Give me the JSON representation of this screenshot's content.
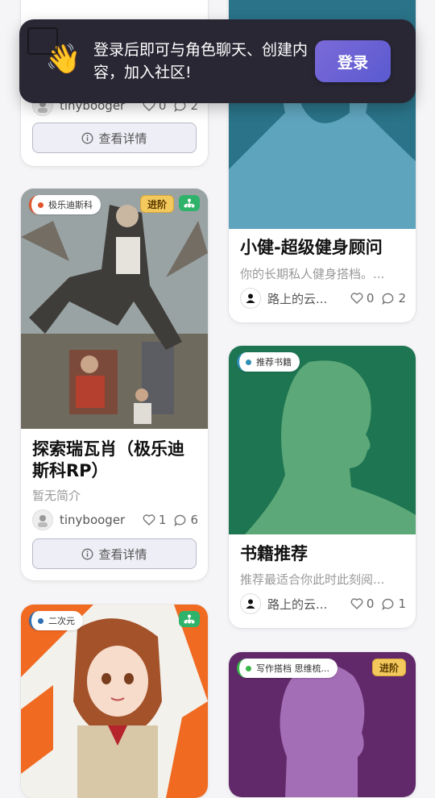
{
  "banner": {
    "emoji": "👋",
    "message": "登录后即可与角色聊天、创建内容，加入社区!",
    "login_label": "登录"
  },
  "cards": {
    "top_left": {
      "author": "tinybooger",
      "likes": "0",
      "comments": "2",
      "details_label": "查看详情"
    },
    "top_right": {
      "title": "小健-超级健身顾问",
      "description": "你的长期私人健身搭档。...",
      "author": "路上的云...",
      "likes": "0",
      "comments": "2"
    },
    "skyrim": {
      "tag": "极乐迪斯科",
      "tag_color": "#e0552b",
      "level": "进阶",
      "title": "探索瑞瓦肖（极乐迪斯科RP）",
      "description": "暂无简介",
      "author": "tinybooger",
      "likes": "1",
      "comments": "6",
      "details_label": "查看详情"
    },
    "books": {
      "tag": "推荐书籍",
      "tag_color": "#2f8fb3",
      "title": "书籍推荐",
      "description": "推荐最适合你此时此刻阅...",
      "author": "路上的云...",
      "likes": "0",
      "comments": "1"
    },
    "anime": {
      "tag": "二次元",
      "tag_color": "#2f6fb3"
    },
    "writing": {
      "tag": "写作搭档 思维梳...",
      "tag_color": "#3ab54a",
      "level": "进阶"
    }
  },
  "icons": {
    "wave": "waving-hand-icon",
    "heart": "heart-icon",
    "comment": "comment-icon",
    "info": "info-icon",
    "workflow": "workflow-icon",
    "user": "user-icon"
  },
  "colors": {
    "banner_bg": "#2a2735",
    "login_button": "#6a62d6",
    "level_badge": "#f3c85c",
    "workflow_badge": "#2fb36a"
  }
}
